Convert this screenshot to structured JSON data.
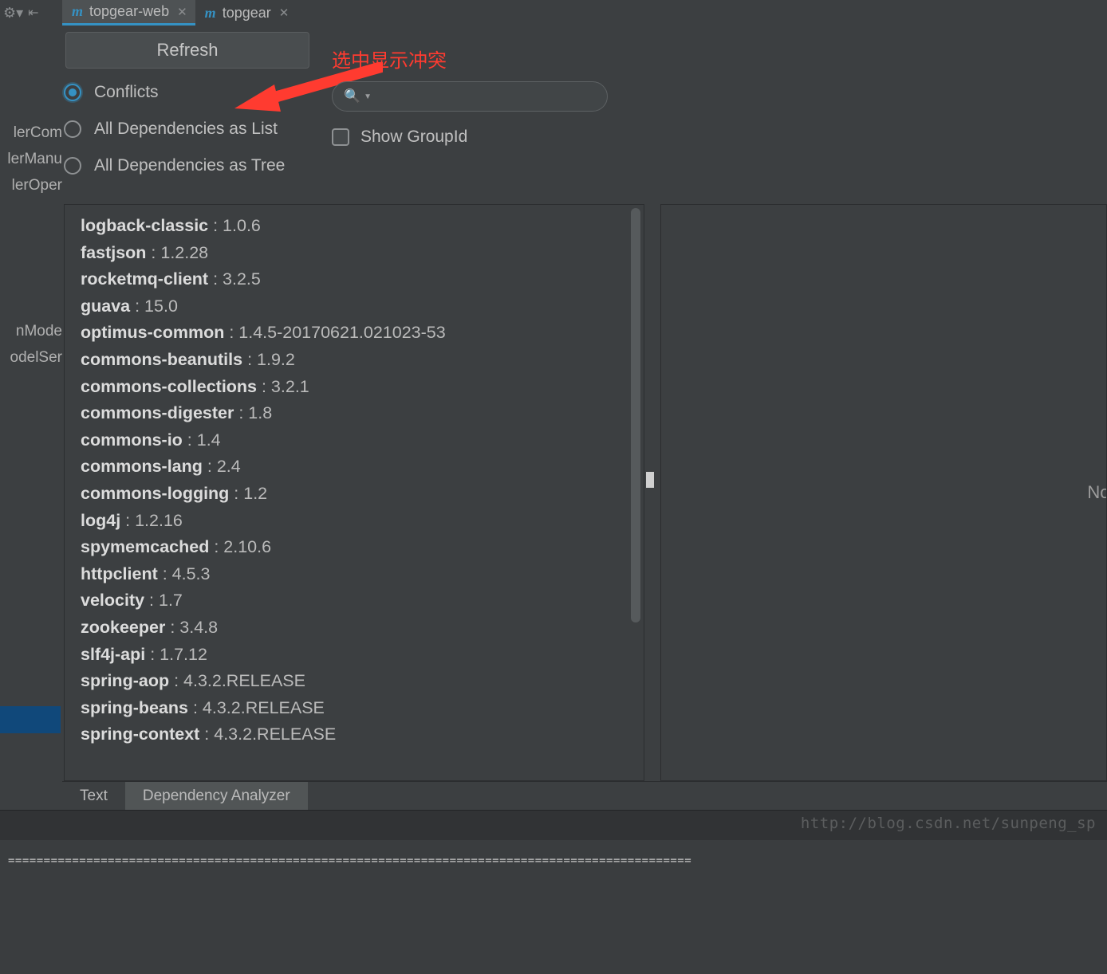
{
  "tabs": [
    {
      "label": "topgear-web",
      "active": true
    },
    {
      "label": "topgear",
      "active": false
    }
  ],
  "toolbar": {
    "refresh_label": "Refresh"
  },
  "annotation": "选中显示冲突",
  "radios": {
    "conflicts": "Conflicts",
    "as_list": "All Dependencies as List",
    "as_tree": "All Dependencies as Tree"
  },
  "search": {
    "placeholder": ""
  },
  "checkbox": {
    "show_groupid": "Show GroupId"
  },
  "left_fragments": {
    "a": "lerCom",
    "b": "lerManu",
    "c": "lerOper",
    "d": "nMode",
    "e": "odelSer"
  },
  "dependencies": [
    {
      "name": "logback-classic",
      "version": "1.0.6"
    },
    {
      "name": "fastjson",
      "version": "1.2.28"
    },
    {
      "name": "rocketmq-client",
      "version": "3.2.5"
    },
    {
      "name": "guava",
      "version": "15.0"
    },
    {
      "name": "optimus-common",
      "version": "1.4.5-20170621.021023-53"
    },
    {
      "name": "commons-beanutils",
      "version": "1.9.2"
    },
    {
      "name": "commons-collections",
      "version": "3.2.1"
    },
    {
      "name": "commons-digester",
      "version": "1.8"
    },
    {
      "name": "commons-io",
      "version": "1.4"
    },
    {
      "name": "commons-lang",
      "version": "2.4"
    },
    {
      "name": "commons-logging",
      "version": "1.2"
    },
    {
      "name": "log4j",
      "version": "1.2.16"
    },
    {
      "name": "spymemcached",
      "version": "2.10.6"
    },
    {
      "name": "httpclient",
      "version": "4.5.3"
    },
    {
      "name": "velocity",
      "version": "1.7"
    },
    {
      "name": "zookeeper",
      "version": "3.4.8"
    },
    {
      "name": "slf4j-api",
      "version": "1.7.12"
    },
    {
      "name": "spring-aop",
      "version": "4.3.2.RELEASE"
    },
    {
      "name": "spring-beans",
      "version": "4.3.2.RELEASE"
    },
    {
      "name": "spring-context",
      "version": "4.3.2.RELEASE"
    }
  ],
  "right_pane_text": "Nothin",
  "bottom_tabs": {
    "text": "Text",
    "analyzer": "Dependency Analyzer"
  },
  "watermark": "http://blog.csdn.net/sunpeng_sp",
  "term_dashes": "================================================================================================"
}
